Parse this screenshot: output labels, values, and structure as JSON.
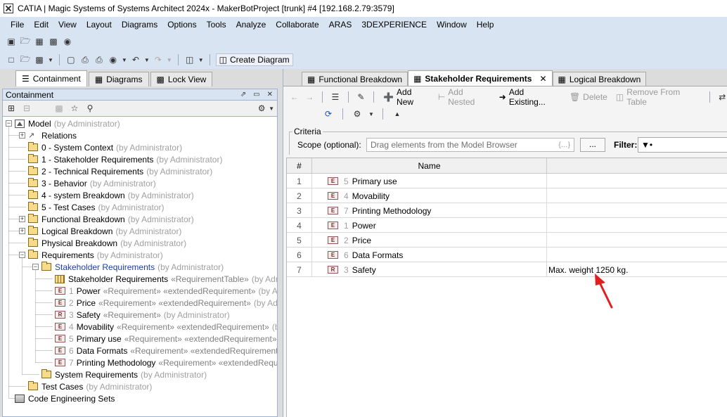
{
  "window": {
    "title": "CATIA | Magic Systems of Systems Architect 2024x - MakerBotProject [trunk] #4 [192.168.2.79:3579]"
  },
  "menu": [
    "File",
    "Edit",
    "View",
    "Layout",
    "Diagrams",
    "Options",
    "Tools",
    "Analyze",
    "Collaborate",
    "ARAS",
    "3DEXPERIENCE",
    "Window",
    "Help"
  ],
  "toolbar": {
    "create_diagram": "Create Diagram"
  },
  "left_tabs": [
    {
      "label": "Containment",
      "icon": "containment-icon"
    },
    {
      "label": "Diagrams",
      "icon": "diagrams-icon"
    },
    {
      "label": "Lock View",
      "icon": "lock-view-icon"
    }
  ],
  "containment": {
    "title": "Containment"
  },
  "tree": [
    {
      "depth": 0,
      "exp": "minus",
      "icon": "model",
      "label": "Model",
      "stereo": "",
      "owner": "(by Administrator)"
    },
    {
      "depth": 1,
      "exp": "plus",
      "icon": "relation",
      "label": "Relations",
      "stereo": "",
      "owner": ""
    },
    {
      "depth": 1,
      "exp": "none",
      "icon": "folder",
      "label": "0 - System Context",
      "stereo": "",
      "owner": "(by Administrator)"
    },
    {
      "depth": 1,
      "exp": "none",
      "icon": "folder",
      "label": "1 - Stakeholder Requirements",
      "stereo": "",
      "owner": "(by Administrator)"
    },
    {
      "depth": 1,
      "exp": "none",
      "icon": "folder",
      "label": "2 - Technical Requirements",
      "stereo": "",
      "owner": "(by Administrator)"
    },
    {
      "depth": 1,
      "exp": "none",
      "icon": "folder",
      "label": "3 - Behavior",
      "stereo": "",
      "owner": "(by Administrator)"
    },
    {
      "depth": 1,
      "exp": "none",
      "icon": "folder",
      "label": "4 - system Breakdown",
      "stereo": "",
      "owner": "(by Administrator)"
    },
    {
      "depth": 1,
      "exp": "none",
      "icon": "folder",
      "label": "5 - Test Cases",
      "stereo": "",
      "owner": "(by Administrator)"
    },
    {
      "depth": 1,
      "exp": "plus",
      "icon": "folder",
      "label": "Functional Breakdown",
      "stereo": "",
      "owner": "(by Administrator)"
    },
    {
      "depth": 1,
      "exp": "plus",
      "icon": "folder",
      "label": "Logical Breakdown",
      "stereo": "",
      "owner": "(by Administrator)"
    },
    {
      "depth": 1,
      "exp": "none",
      "icon": "folder",
      "label": "Physical Breakdown",
      "stereo": "",
      "owner": "(by Administrator)"
    },
    {
      "depth": 1,
      "exp": "minus",
      "icon": "folder",
      "label": "Requirements",
      "stereo": "",
      "owner": "(by Administrator)"
    },
    {
      "depth": 2,
      "exp": "minus",
      "icon": "folder",
      "label": "Stakeholder Requirements",
      "stereo": "",
      "owner": "(by Administrator)",
      "blue": true
    },
    {
      "depth": 3,
      "exp": "none",
      "icon": "table",
      "label": "Stakeholder Requirements",
      "stereo": "«RequirementTable»",
      "owner": "(by Adm"
    },
    {
      "depth": 3,
      "exp": "none",
      "icon": "req",
      "idx": "1",
      "label": "Power",
      "stereo": "«Requirement» «extendedRequirement»",
      "owner": "(by Ad"
    },
    {
      "depth": 3,
      "exp": "none",
      "icon": "req",
      "idx": "2",
      "label": "Price",
      "stereo": "«Requirement» «extendedRequirement»",
      "owner": "(by Adm"
    },
    {
      "depth": 3,
      "exp": "none",
      "icon": "reqR",
      "idx": "3",
      "label": "Safety",
      "stereo": "«Requirement»",
      "owner": "(by Administrator)"
    },
    {
      "depth": 3,
      "exp": "none",
      "icon": "req",
      "idx": "4",
      "label": "Movability",
      "stereo": "«Requirement» «extendedRequirement»",
      "owner": "(b"
    },
    {
      "depth": 3,
      "exp": "none",
      "icon": "req",
      "idx": "5",
      "label": "Primary use",
      "stereo": "«Requirement» «extendedRequirement»",
      "owner": "("
    },
    {
      "depth": 3,
      "exp": "none",
      "icon": "req",
      "idx": "6",
      "label": "Data Formats",
      "stereo": "«Requirement» «extendedRequirement»",
      "owner": ""
    },
    {
      "depth": 3,
      "exp": "none",
      "icon": "req",
      "idx": "7",
      "label": "Printing Methodology",
      "stereo": "«Requirement» «extendedRequ",
      "owner": ""
    },
    {
      "depth": 2,
      "exp": "none",
      "icon": "folder",
      "label": "System Requirements",
      "stereo": "",
      "owner": "(by Administrator)"
    },
    {
      "depth": 1,
      "exp": "none",
      "icon": "folder",
      "label": "Test Cases",
      "stereo": "",
      "owner": "(by Administrator)"
    },
    {
      "depth": 0,
      "exp": "none",
      "icon": "code",
      "label": "Code Engineering Sets",
      "stereo": "",
      "owner": ""
    }
  ],
  "right_tabs": [
    {
      "label": "Functional Breakdown",
      "active": false
    },
    {
      "label": "Stakeholder Requirements",
      "active": true
    },
    {
      "label": "Logical Breakdown",
      "active": false
    }
  ],
  "table_toolbar": {
    "add_new": "Add New",
    "add_nested": "Add Nested",
    "add_existing": "Add Existing...",
    "delete": "Delete",
    "remove_from_table": "Remove From Table"
  },
  "criteria": {
    "legend": "Criteria",
    "scope_label": "Scope (optional):",
    "scope_placeholder": "Drag elements from the Model Browser",
    "braces": "{…}",
    "dots": "...",
    "filter_label": "Filter:"
  },
  "grid": {
    "columns": [
      "#",
      "Name",
      ""
    ],
    "rows": [
      {
        "num": "1",
        "icon": "E",
        "idx": "5",
        "name": "Primary use",
        "text": ""
      },
      {
        "num": "2",
        "icon": "E",
        "idx": "4",
        "name": "Movability",
        "text": ""
      },
      {
        "num": "3",
        "icon": "E",
        "idx": "7",
        "name": "Printing Methodology",
        "text": ""
      },
      {
        "num": "4",
        "icon": "E",
        "idx": "1",
        "name": "Power",
        "text": ""
      },
      {
        "num": "5",
        "icon": "E",
        "idx": "2",
        "name": "Price",
        "text": ""
      },
      {
        "num": "6",
        "icon": "E",
        "idx": "6",
        "name": "Data Formats",
        "text": ""
      },
      {
        "num": "7",
        "icon": "R",
        "idx": "3",
        "name": "Safety",
        "text": "Max. weight 1250 kg."
      }
    ]
  },
  "colors": {
    "annotation_arrow": "#e02020",
    "link_blue": "#1a3fa8"
  }
}
